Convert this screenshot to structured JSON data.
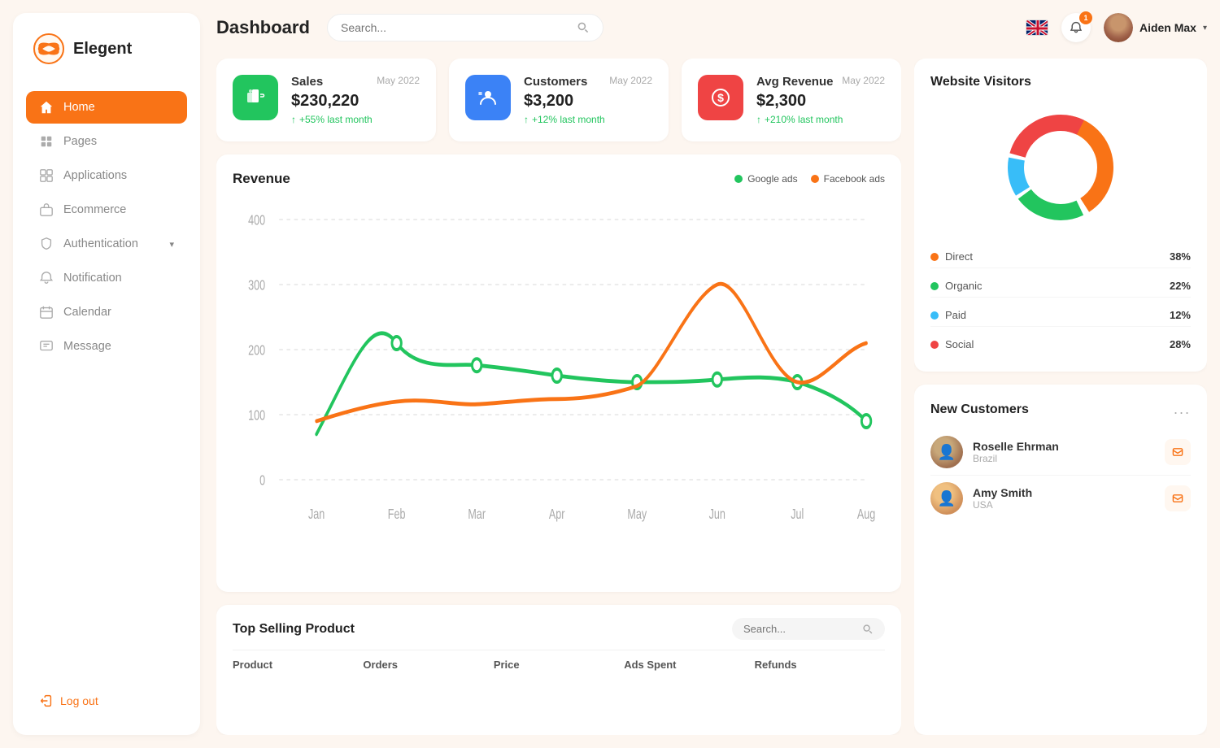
{
  "app": {
    "name": "Elegent"
  },
  "header": {
    "title": "Dashboard",
    "search_placeholder": "Search...",
    "user_name": "Aiden Max",
    "notification_count": "1"
  },
  "sidebar": {
    "items": [
      {
        "id": "home",
        "label": "Home",
        "icon": "home",
        "active": true
      },
      {
        "id": "pages",
        "label": "Pages",
        "icon": "pages",
        "active": false
      },
      {
        "id": "applications",
        "label": "Applications",
        "icon": "apps",
        "active": false
      },
      {
        "id": "ecommerce",
        "label": "Ecommerce",
        "icon": "bag",
        "active": false
      },
      {
        "id": "authentication",
        "label": "Authentication",
        "icon": "shield",
        "active": false,
        "has_chevron": true
      },
      {
        "id": "notification",
        "label": "Notification",
        "icon": "bell",
        "active": false
      },
      {
        "id": "calendar",
        "label": "Calendar",
        "icon": "calendar",
        "active": false
      },
      {
        "id": "message",
        "label": "Message",
        "icon": "message",
        "active": false
      }
    ],
    "logout_label": "Log out"
  },
  "stats": [
    {
      "id": "sales",
      "title": "Sales",
      "date": "May 2022",
      "value": "$230,220",
      "change": "+55% last month",
      "color": "green"
    },
    {
      "id": "customers",
      "title": "Customers",
      "date": "May 2022",
      "value": "$3,200",
      "change": "+12% last month",
      "color": "blue"
    },
    {
      "id": "avg_revenue",
      "title": "Avg Revenue",
      "date": "May 2022",
      "value": "$2,300",
      "change": "+210% last month",
      "color": "red"
    }
  ],
  "revenue_chart": {
    "title": "Revenue",
    "legend": [
      {
        "id": "google_ads",
        "label": "Google ads",
        "color": "#22c55e"
      },
      {
        "id": "facebook_ads",
        "label": "Facebook ads",
        "color": "#f97316"
      }
    ],
    "x_labels": [
      "Jan",
      "Feb",
      "Mar",
      "Apr",
      "May",
      "Jun",
      "Jul",
      "Aug"
    ],
    "y_labels": [
      "0",
      "100",
      "200",
      "300",
      "400"
    ]
  },
  "website_visitors": {
    "title": "Website Visitors",
    "segments": [
      {
        "id": "direct",
        "label": "Direct",
        "pct": "38%",
        "color": "#f97316",
        "value": 38
      },
      {
        "id": "organic",
        "label": "Organic",
        "pct": "22%",
        "color": "#22c55e",
        "value": 22
      },
      {
        "id": "paid",
        "label": "Paid",
        "pct": "12%",
        "color": "#38bdf8",
        "value": 12
      },
      {
        "id": "social",
        "label": "Social",
        "pct": "28%",
        "color": "#ef4444",
        "value": 28
      }
    ]
  },
  "new_customers": {
    "title": "New Customers",
    "more_label": "...",
    "items": [
      {
        "id": "c1",
        "name": "Roselle Ehrman",
        "country": "Brazil",
        "bg": "#c8a87a"
      },
      {
        "id": "c2",
        "name": "Amy Smith",
        "country": "USA",
        "bg": "#f0b77a"
      }
    ]
  },
  "top_selling": {
    "title": "Top Selling Product",
    "search_placeholder": "Search...",
    "columns": [
      "Product",
      "Orders",
      "Price",
      "Ads Spent",
      "Refunds"
    ]
  }
}
